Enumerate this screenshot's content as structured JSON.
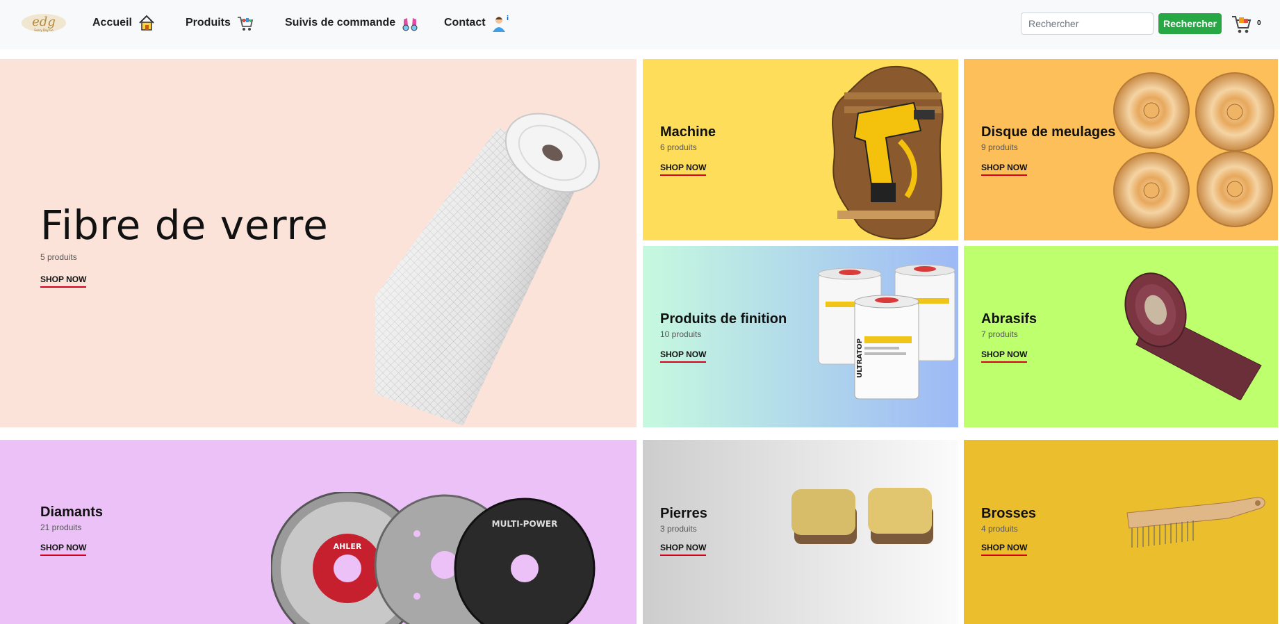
{
  "header": {
    "logo_alt": "edg",
    "nav": [
      {
        "label": "Accueil",
        "icon": "house-icon"
      },
      {
        "label": "Produits",
        "icon": "shopping-cart-icon"
      },
      {
        "label": "Suivis de commande",
        "icon": "binoculars-icon"
      },
      {
        "label": "Contact",
        "icon": "person-info-icon"
      }
    ],
    "search": {
      "placeholder": "Rechercher",
      "button_label": "Rechercher"
    },
    "cart": {
      "icon": "cart-icon",
      "count": "0"
    }
  },
  "tiles": {
    "fibre": {
      "title": "Fibre de verre",
      "count": "5 produits",
      "cta": "SHOP NOW",
      "color": "#fbe3d9"
    },
    "machine": {
      "title": "Machine",
      "count": "6 produits",
      "cta": "SHOP NOW",
      "color": "#fedd5a"
    },
    "disque": {
      "title": "Disque de meulages",
      "count": "9 produits",
      "cta": "SHOP NOW",
      "color": "#fdbf5a"
    },
    "finition": {
      "title": "Produits de finition",
      "count": "10 produits",
      "cta": "SHOP NOW",
      "label": "ULTRATOP"
    },
    "abrasifs": {
      "title": "Abrasifs",
      "count": "7 produits",
      "cta": "SHOP NOW",
      "color": "#bdff6c"
    },
    "diamants": {
      "title": "Diamants",
      "count": "21 produits",
      "cta": "SHOP NOW",
      "color": "#ecc1f7",
      "disc_brand": "AHLER",
      "disc_name": "MULTI-POWER"
    },
    "pierres": {
      "title": "Pierres",
      "count": "3 produits",
      "cta": "SHOP NOW"
    },
    "brosses": {
      "title": "Brosses",
      "count": "4 produits",
      "cta": "SHOP NOW",
      "color": "#ebbe2e"
    }
  },
  "colors": {
    "accent_green": "#28a745",
    "underline_red": "#d3001b"
  }
}
